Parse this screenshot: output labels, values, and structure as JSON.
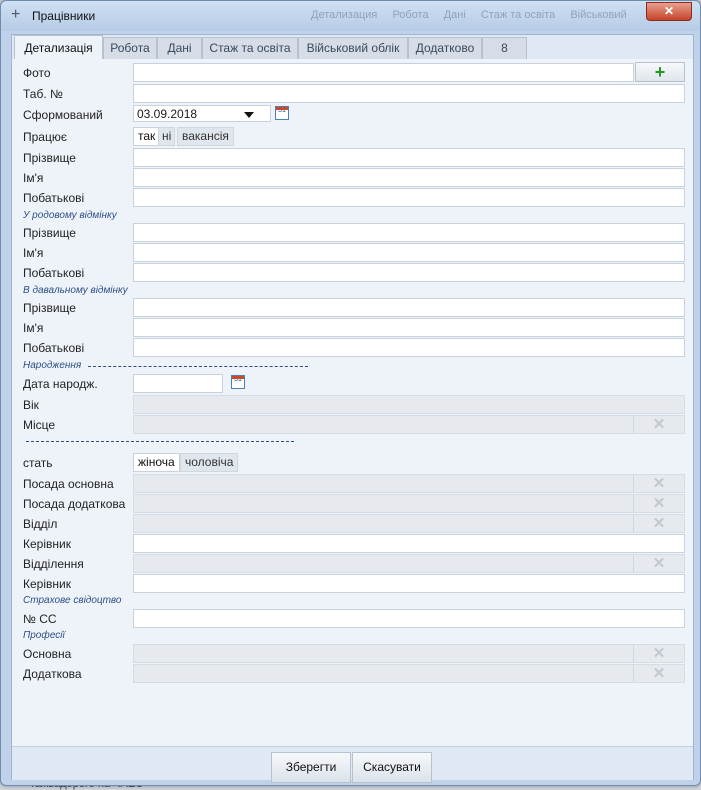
{
  "background": {
    "taskbar_text": "тажвадорого на ЧАЕС"
  },
  "window": {
    "title": "Працівники",
    "close_label": "✕",
    "ghost_tabs": [
      "Детализация",
      "Робота",
      "Дані",
      "Стаж та освіта",
      "Військовий"
    ]
  },
  "tabs": [
    "Детализація",
    "Робота",
    "Дані",
    "Стаж та освіта",
    "Військовий облік",
    "Додатково",
    "8"
  ],
  "form": {
    "photo_label": "Фото",
    "tab_no_label": "Таб. №",
    "formed_label": "Сформований",
    "formed_value": "03.09.2018",
    "works_label": "Працює",
    "works_options": [
      "так",
      "ні",
      "вакансія"
    ],
    "works_selected": "так",
    "surname_label": "Прізвище",
    "name_label": "Ім'я",
    "patronymic_label": "Побатькові",
    "genitive_section": "У родовому відмінку",
    "dative_section": "В давальному відмінку",
    "birth_section": "Народження",
    "birth_date_label": "Дата народж.",
    "age_label": "Вік",
    "place_label": "Місце",
    "gender_label": "стать",
    "gender_options": [
      "жіноча",
      "чоловіча"
    ],
    "gender_selected": "жіноча",
    "main_position_label": "Посада основна",
    "extra_position_label": "Посада додаткова",
    "department_label": "Відділ",
    "head1_label": "Керівник",
    "division_label": "Відділення",
    "head2_label": "Керівник",
    "insurance_section": "Страхове свідоцтво",
    "ss_no_label": "№ СС",
    "professions_section": "Професії",
    "main_label": "Основна",
    "extra_label": "Додаткова"
  },
  "buttons": {
    "save": "Зберегти",
    "cancel": "Скасувати"
  },
  "icons": {
    "add": "plus-icon",
    "clear": "x-icon",
    "calendar": "calendar-icon",
    "dropdown": "caret-down-icon"
  },
  "colors": {
    "accent": "#2c4f86",
    "add_green": "#1f9a1f",
    "close_red": "#c5432a"
  }
}
